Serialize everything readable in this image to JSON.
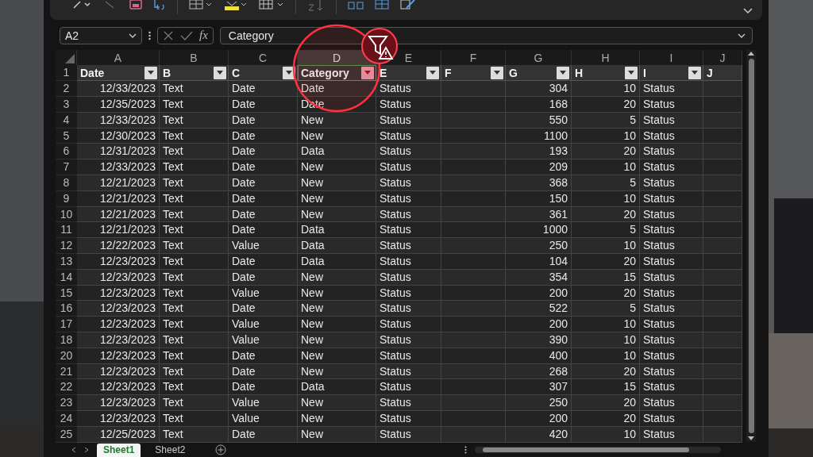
{
  "formula_bar": {
    "name_box": "A2",
    "function_label": "fx",
    "formula": "Category"
  },
  "columns": [
    {
      "letter": "A",
      "right_aligned": true,
      "selected": false
    },
    {
      "letter": "B",
      "right_aligned": false,
      "selected": false
    },
    {
      "letter": "C",
      "right_aligned": false,
      "selected": false
    },
    {
      "letter": "D",
      "right_aligned": false,
      "selected": true
    },
    {
      "letter": "E",
      "right_aligned": false,
      "selected": false
    },
    {
      "letter": "F",
      "selected": false
    },
    {
      "letter": "G",
      "right_aligned": true,
      "selected": false
    },
    {
      "letter": "H",
      "right_aligned": true,
      "selected": false
    },
    {
      "letter": "I",
      "right_aligned": false,
      "selected": false
    },
    {
      "letter": "J",
      "selected": false
    }
  ],
  "header_row": {
    "number": "1",
    "cells": [
      {
        "text": "Date",
        "filter": true,
        "filter_active": false
      },
      {
        "text": "B",
        "filter": true,
        "filter_active": false
      },
      {
        "text": "C",
        "filter": true,
        "filter_active": false
      },
      {
        "text": "Category",
        "filter": true,
        "filter_active": true
      },
      {
        "text": "E",
        "filter": true,
        "filter_active": false
      },
      {
        "text": "F",
        "filter": true,
        "filter_active": false
      },
      {
        "text": "G",
        "filter": true,
        "filter_active": false
      },
      {
        "text": "H",
        "filter": true,
        "filter_active": false
      },
      {
        "text": "I",
        "filter": true,
        "filter_active": false
      },
      {
        "text": "J",
        "filter": false
      }
    ]
  },
  "rows": [
    {
      "number": "2",
      "cells": [
        "12/33/2023",
        "Text",
        "Date",
        "Date",
        "Status",
        "",
        "304",
        "10",
        "Status",
        ""
      ]
    },
    {
      "number": "3",
      "cells": [
        "12/35/2023",
        "Text",
        "Date",
        "Date",
        "Status",
        "",
        "168",
        "20",
        "Status",
        ""
      ]
    },
    {
      "number": "4",
      "cells": [
        "12/33/2023",
        "Text",
        "Date",
        "New",
        "Status",
        "",
        "550",
        "5",
        "Status",
        ""
      ]
    },
    {
      "number": "5",
      "cells": [
        "12/30/2023",
        "Text",
        "Date",
        "New",
        "Status",
        "",
        "1100",
        "10",
        "Status",
        ""
      ]
    },
    {
      "number": "6",
      "cells": [
        "12/31/2023",
        "Text",
        "Date",
        "Data",
        "Status",
        "",
        "193",
        "20",
        "Status",
        ""
      ]
    },
    {
      "number": "7",
      "cells": [
        "12/33/2023",
        "Text",
        "Date",
        "New",
        "Status",
        "",
        "209",
        "10",
        "Status",
        ""
      ]
    },
    {
      "number": "8",
      "cells": [
        "12/21/2023",
        "Text",
        "Date",
        "New",
        "Status",
        "",
        "368",
        "5",
        "Status",
        ""
      ]
    },
    {
      "number": "9",
      "cells": [
        "12/21/2023",
        "Text",
        "Date",
        "New",
        "Status",
        "",
        "150",
        "10",
        "Status",
        ""
      ]
    },
    {
      "number": "10",
      "cells": [
        "12/21/2023",
        "Text",
        "Date",
        "New",
        "Status",
        "",
        "361",
        "20",
        "Status",
        ""
      ]
    },
    {
      "number": "11",
      "cells": [
        "12/21/2023",
        "Text",
        "Date",
        "Data",
        "Status",
        "",
        "1000",
        "5",
        "Status",
        ""
      ]
    },
    {
      "number": "12",
      "cells": [
        "12/22/2023",
        "Text",
        "Value",
        "Data",
        "Status",
        "",
        "250",
        "10",
        "Status",
        ""
      ]
    },
    {
      "number": "13",
      "cells": [
        "12/23/2023",
        "Text",
        "Date",
        "Data",
        "Status",
        "",
        "104",
        "20",
        "Status",
        ""
      ]
    },
    {
      "number": "14",
      "cells": [
        "12/23/2023",
        "Text",
        "Date",
        "New",
        "Status",
        "",
        "354",
        "15",
        "Status",
        ""
      ]
    },
    {
      "number": "15",
      "cells": [
        "12/23/2023",
        "Text",
        "Value",
        "New",
        "Status",
        "",
        "200",
        "20",
        "Status",
        ""
      ]
    },
    {
      "number": "16",
      "cells": [
        "12/23/2023",
        "Text",
        "Date",
        "New",
        "Status",
        "",
        "522",
        "5",
        "Status",
        ""
      ]
    },
    {
      "number": "17",
      "cells": [
        "12/23/2023",
        "Text",
        "Value",
        "New",
        "Status",
        "",
        "200",
        "10",
        "Status",
        ""
      ]
    },
    {
      "number": "18",
      "cells": [
        "12/23/2023",
        "Text",
        "Value",
        "New",
        "Status",
        "",
        "390",
        "10",
        "Status",
        ""
      ]
    },
    {
      "number": "20",
      "cells": [
        "12/23/2023",
        "Text",
        "Date",
        "New",
        "Status",
        "",
        "400",
        "10",
        "Status",
        ""
      ]
    },
    {
      "number": "21",
      "cells": [
        "12/23/2023",
        "Text",
        "Date",
        "New",
        "Status",
        "",
        "268",
        "20",
        "Status",
        ""
      ]
    },
    {
      "number": "22",
      "cells": [
        "12/23/2023",
        "Text",
        "Date",
        "Data",
        "Status",
        "",
        "307",
        "15",
        "Status",
        ""
      ]
    },
    {
      "number": "23",
      "cells": [
        "12/23/2023",
        "Text",
        "Value",
        "New",
        "Status",
        "",
        "250",
        "20",
        "Status",
        ""
      ]
    },
    {
      "number": "24",
      "cells": [
        "12/23/2023",
        "Text",
        "Value",
        "New",
        "Status",
        "",
        "200",
        "20",
        "Status",
        ""
      ]
    },
    {
      "number": "25",
      "cells": [
        "12/25/2023",
        "Text",
        "Date",
        "New",
        "Status",
        "",
        "420",
        "10",
        "Status",
        ""
      ]
    }
  ],
  "callout": {
    "kind": "filter-warning"
  },
  "sheets": [
    {
      "name": "Sheet1",
      "selected": true
    },
    {
      "name": "Sheet2",
      "selected": false
    }
  ]
}
